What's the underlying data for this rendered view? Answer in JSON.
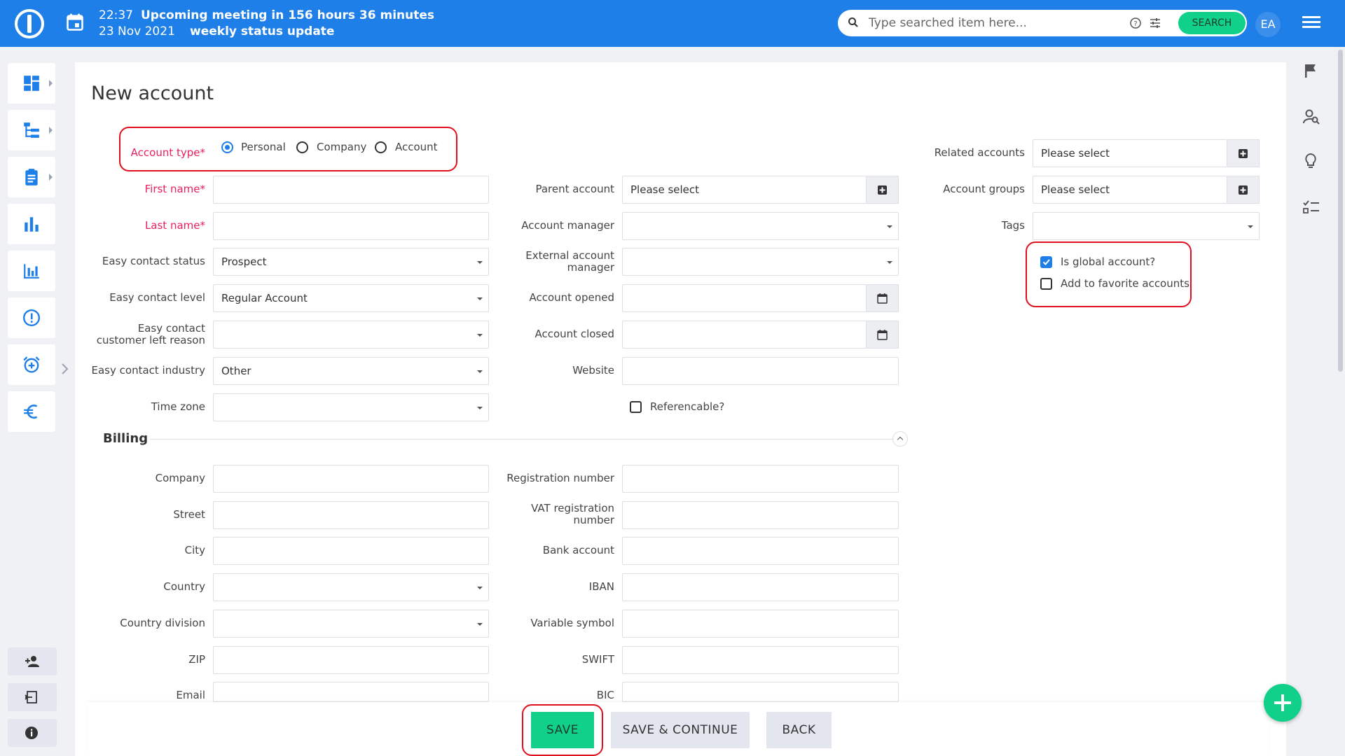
{
  "topbar": {
    "time": "22:37",
    "meeting_title": "Upcoming meeting in 156 hours 36 minutes",
    "date": "23 Nov 2021",
    "meeting_name": "weekly status update",
    "search_placeholder": "Type searched item here...",
    "search_button": "SEARCH",
    "avatar_initials": "EA",
    "brand_color": "#1e7fe8"
  },
  "leftnav": {
    "items": [
      "dashboard-icon",
      "tree-icon",
      "clipboard-icon",
      "bar-chart-icon",
      "column-chart-icon",
      "alert-icon",
      "alarm-add-icon",
      "euro-icon"
    ],
    "bottom": [
      "add-user-icon",
      "logout-icon",
      "info-icon"
    ]
  },
  "rightrail": [
    "flag-icon",
    "person-search-icon",
    "lightbulb-icon",
    "checklist-icon"
  ],
  "page": {
    "title": "New account"
  },
  "account_type": {
    "label": "Account type*",
    "options": [
      "Personal",
      "Company",
      "Account"
    ],
    "selected": "Personal"
  },
  "left_fields": {
    "first_name": {
      "label": "First name*",
      "value": ""
    },
    "last_name": {
      "label": "Last name*",
      "value": ""
    },
    "contact_status": {
      "label": "Easy contact status",
      "value": "Prospect"
    },
    "contact_level": {
      "label": "Easy contact level",
      "value": "Regular Account"
    },
    "left_reason": {
      "label1": "Easy contact",
      "label2": "customer left reason",
      "value": ""
    },
    "industry": {
      "label": "Easy contact industry",
      "value": "Other"
    },
    "time_zone": {
      "label": "Time zone",
      "value": ""
    }
  },
  "middle_fields": {
    "parent_account": {
      "label": "Parent account",
      "value": "Please select"
    },
    "account_manager": {
      "label": "Account manager",
      "value": ""
    },
    "external_manager": {
      "label1": "External account",
      "label2": "manager",
      "value": ""
    },
    "account_opened": {
      "label": "Account opened",
      "value": ""
    },
    "account_closed": {
      "label": "Account closed",
      "value": ""
    },
    "website": {
      "label": "Website",
      "value": ""
    },
    "referencable": {
      "label": "Referencable?",
      "checked": false
    }
  },
  "right_fields": {
    "related_accounts": {
      "label": "Related accounts",
      "value": "Please select"
    },
    "account_groups": {
      "label": "Account groups",
      "value": "Please select"
    },
    "tags": {
      "label": "Tags",
      "value": ""
    },
    "is_global": {
      "label": "Is global account?",
      "checked": true
    },
    "favorite": {
      "label": "Add to favorite accounts",
      "checked": false
    }
  },
  "billing": {
    "title": "Billing",
    "left": {
      "company": "Company",
      "street": "Street",
      "city": "City",
      "country": "Country",
      "country_division": "Country division",
      "zip": "ZIP",
      "email": "Email"
    },
    "right": {
      "registration": "Registration number",
      "vat1": "VAT registration",
      "vat2": "number",
      "bank": "Bank account",
      "iban": "IBAN",
      "variable": "Variable symbol",
      "swift": "SWIFT",
      "bic": "BIC"
    }
  },
  "footer": {
    "save": "SAVE",
    "save_continue": "SAVE & CONTINUE",
    "back": "BACK"
  }
}
